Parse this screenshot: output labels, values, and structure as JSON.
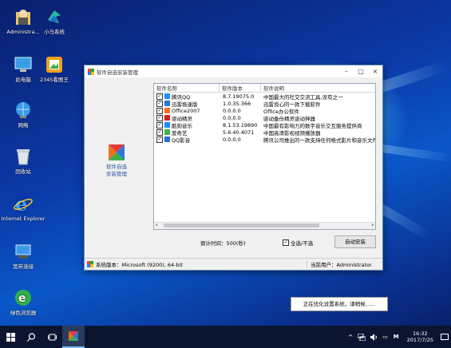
{
  "desktop": {
    "icons": [
      {
        "label": "Administra...",
        "icon": "user-folder-icon"
      },
      {
        "label": "小马系统",
        "icon": "horse-logo-icon"
      },
      {
        "label": "此电脑",
        "icon": "computer-icon"
      },
      {
        "label": "2345看图王",
        "icon": "image-viewer-icon"
      },
      {
        "label": "网络",
        "icon": "network-icon"
      },
      {
        "label": "回收站",
        "icon": "recycle-bin-icon"
      },
      {
        "label": "Internet Explorer",
        "icon": "ie-icon"
      },
      {
        "label": "宽带连接",
        "icon": "broadband-icon"
      },
      {
        "label": "绿色浏览器",
        "icon": "green-browser-icon"
      }
    ]
  },
  "window": {
    "title": "软件自选安装管理",
    "left_label": "软件自选\n安装管理",
    "columns": [
      "软件名称",
      "软件版本",
      "软件说明"
    ],
    "software": [
      {
        "name": "腾讯QQ",
        "version": "8.7.19075.0",
        "desc": "中国最大的社交交流工具,没有之一",
        "color": "#1e90ff",
        "checked": "✓"
      },
      {
        "name": "迅雷极速版",
        "version": "1.0.35.366",
        "desc": "迅雷良心的一款下载软件",
        "color": "#2a7ad5",
        "checked": "✓"
      },
      {
        "name": "Office2007",
        "version": "0.0.0.0",
        "desc": "Office办公软件",
        "color": "#e8731e",
        "checked": "✓"
      },
      {
        "name": "驱动精灵",
        "version": "0.0.0.0",
        "desc": "驱动备份精灵驱动神器",
        "color": "#d42020",
        "checked": "✓"
      },
      {
        "name": "酷狗音乐",
        "version": "8.1.53.19890",
        "desc": "中国最有影响力的数字音乐交互服务提供商",
        "color": "#1a8cff",
        "checked": "✓"
      },
      {
        "name": "爱奇艺",
        "version": "5.6.40.4071",
        "desc": "中国高清影视视频播放器",
        "color": "#3cb34a",
        "checked": "✓"
      },
      {
        "name": "QQ影音",
        "version": "0.0.0.0",
        "desc": "腾讯公司推出的一款支持任何格式影片和音乐文件的播放器",
        "color": "#2f6fd6",
        "checked": "✓"
      }
    ],
    "countdown": "倒计时间：500(秒)",
    "select_all": "全选/不选",
    "select_all_checked": "✓",
    "install_button": "自动安装",
    "status_os": "系统版本：Microsoft  (9200), 64-bit",
    "status_user": "当前用户：Administrator"
  },
  "toast": "正在优化设置系统，请稍候......",
  "taskbar": {
    "time": "16:32",
    "date": "2017/7/25",
    "ime": "M",
    "tray_caret": "^"
  }
}
